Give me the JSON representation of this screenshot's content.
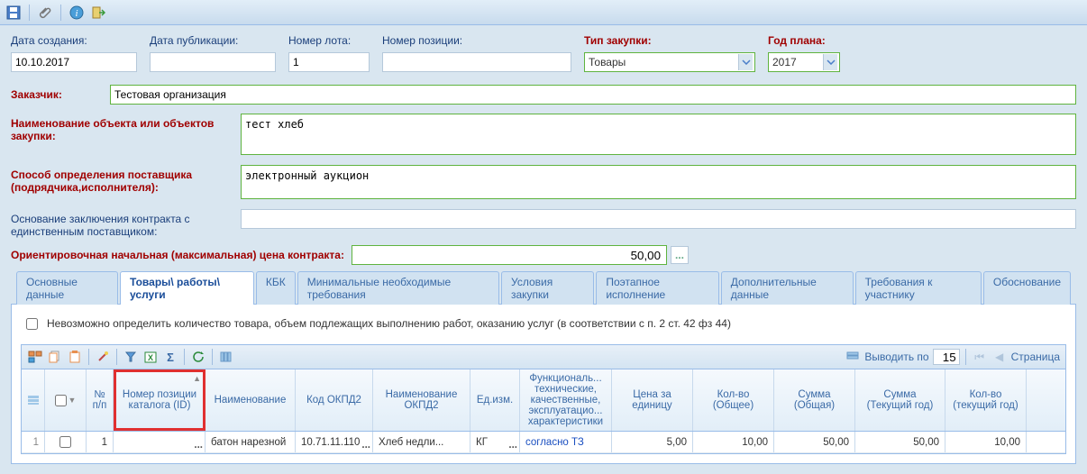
{
  "form": {
    "created_label": "Дата создания:",
    "created_value": "10.10.2017",
    "published_label": "Дата публикации:",
    "published_value": "",
    "lot_label": "Номер лота:",
    "lot_value": "1",
    "pos_label": "Номер позиции:",
    "pos_value": "",
    "type_label": "Тип закупки:",
    "type_value": "Товары",
    "year_label": "Год плана:",
    "year_value": "2017",
    "customer_label": "Заказчик:",
    "customer_value": "Тестовая организация",
    "objname_label": "Наименование объекта или объектов закупки:",
    "objname_value": "тест хлеб",
    "method_label": "Способ определения поставщика (подрядчика,исполнителя):",
    "method_value": "электронный аукцион",
    "basis_label": "Основание заключения контракта с единственным поставщиком:",
    "basis_value": "",
    "price_label": "Ориентировочная начальная (максимальная) цена контракта:",
    "price_value": "50,00",
    "price_btn": "..."
  },
  "tabs": [
    {
      "label": "Основные данные",
      "active": false
    },
    {
      "label": "Товары\\ работы\\ услуги",
      "active": true
    },
    {
      "label": "КБК",
      "active": false
    },
    {
      "label": "Минимальные необходимые требования",
      "active": false
    },
    {
      "label": "Условия закупки",
      "active": false
    },
    {
      "label": "Поэтапное исполнение",
      "active": false
    },
    {
      "label": "Дополнительные данные",
      "active": false
    },
    {
      "label": "Требования к участнику",
      "active": false
    },
    {
      "label": "Обоснование",
      "active": false
    }
  ],
  "pane": {
    "checkbox_label": "Невозможно определить количество товара, объем подлежащих выполнению работ, оказанию услуг (в соответствии с п. 2 ст. 42 фз 44)",
    "pager_label": "Выводить по",
    "pager_value": "15",
    "page_label": "Страница"
  },
  "grid": {
    "cols": {
      "np": "№ п/п",
      "id": "Номер позиции каталога (ID)",
      "name": "Наименование",
      "okpd": "Код ОКПД2",
      "nokpd": "Наименование ОКПД2",
      "ed": "Ед.изм.",
      "func": "Функциональ... технические, качественные, эксплуатацио... характеристики",
      "price": "Цена за единицу",
      "qty": "Кол-во (Общее)",
      "sum": "Сумма (Общая)",
      "sumy": "Сумма (Текущий год)",
      "qtyy": "Кол-во (текущий год)"
    },
    "rows": [
      {
        "rownum": "1",
        "np": "1",
        "id": "",
        "name": "батон нарезной",
        "okpd": "10.71.11.110",
        "nokpd": "Хлеб недли...",
        "ed": "КГ",
        "func": "согласно ТЗ",
        "price": "5,00",
        "qty": "10,00",
        "sum": "50,00",
        "sumy": "50,00",
        "qtyy": "10,00"
      }
    ]
  }
}
